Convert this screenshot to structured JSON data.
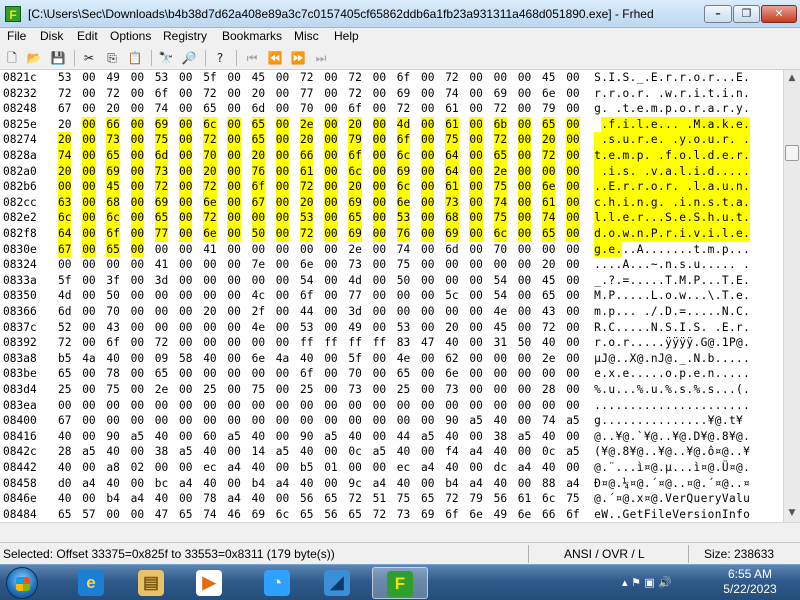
{
  "window": {
    "title": "[C:\\Users\\Sec\\Downloads\\b4b38d7d62a408e89a3c7c0157405cf65862ddb6a1fb23a931311a468d051890.exe] - Frhed",
    "app_icon_letter": "F",
    "min_glyph": "–",
    "max_glyph": "❐",
    "close_glyph": "✕"
  },
  "menu": [
    "File",
    "Disk",
    "Edit",
    "Options",
    "Registry",
    "Bookmarks",
    "Misc",
    "Help"
  ],
  "toolbar": {
    "buttons": [
      {
        "name": "new-file-icon",
        "glyph": "🗋",
        "disabled": false
      },
      {
        "name": "open-folder-icon",
        "glyph": "📂",
        "disabled": false
      },
      {
        "name": "save-icon",
        "glyph": "💾",
        "disabled": false
      },
      {
        "name": "cut-icon",
        "glyph": "✂",
        "disabled": false
      },
      {
        "name": "copy-icon",
        "glyph": "⎘",
        "disabled": false
      },
      {
        "name": "paste-icon",
        "glyph": "📋",
        "disabled": false
      },
      {
        "name": "find-icon",
        "glyph": "🔭",
        "disabled": false
      },
      {
        "name": "replace-icon",
        "glyph": "🔎",
        "disabled": false
      },
      {
        "name": "help-icon",
        "glyph": "?",
        "disabled": false
      },
      {
        "name": "bookmark-first-icon",
        "glyph": "⏮",
        "disabled": true
      },
      {
        "name": "bookmark-prev-icon",
        "glyph": "⏪",
        "disabled": true
      },
      {
        "name": "bookmark-next-icon",
        "glyph": "⏩",
        "disabled": true
      },
      {
        "name": "bookmark-last-icon",
        "glyph": "⏭",
        "disabled": true
      }
    ]
  },
  "hex": {
    "rows": [
      {
        "offset": "0821c",
        "bytes": [
          "53",
          "00",
          "49",
          "00",
          "53",
          "00",
          "5f",
          "00",
          "45",
          "00",
          "72",
          "00",
          "72",
          "00",
          "6f",
          "00",
          "72",
          "00",
          "00",
          "00",
          "45",
          "00"
        ],
        "ascii": "S.I.S._.E.r.r.o.r...E.",
        "sel": [
          0,
          0
        ]
      },
      {
        "offset": "08232",
        "bytes": [
          "72",
          "00",
          "72",
          "00",
          "6f",
          "00",
          "72",
          "00",
          "20",
          "00",
          "77",
          "00",
          "72",
          "00",
          "69",
          "00",
          "74",
          "00",
          "69",
          "00",
          "6e",
          "00"
        ],
        "ascii": "r.r.o.r. .w.r.i.t.i.n.",
        "sel": [
          0,
          0
        ]
      },
      {
        "offset": "08248",
        "bytes": [
          "67",
          "00",
          "20",
          "00",
          "74",
          "00",
          "65",
          "00",
          "6d",
          "00",
          "70",
          "00",
          "6f",
          "00",
          "72",
          "00",
          "61",
          "00",
          "72",
          "00",
          "79",
          "00"
        ],
        "ascii": "g. .t.e.m.p.o.r.a.r.y.",
        "sel": [
          0,
          0
        ]
      },
      {
        "offset": "0825e",
        "bytes": [
          "20",
          "00",
          "66",
          "00",
          "69",
          "00",
          "6c",
          "00",
          "65",
          "00",
          "2e",
          "00",
          "20",
          "00",
          "4d",
          "00",
          "61",
          "00",
          "6b",
          "00",
          "65",
          "00"
        ],
        "ascii": " .f.i.l.e... .M.a.k.e.",
        "sel": [
          1,
          22
        ]
      },
      {
        "offset": "08274",
        "bytes": [
          "20",
          "00",
          "73",
          "00",
          "75",
          "00",
          "72",
          "00",
          "65",
          "00",
          "20",
          "00",
          "79",
          "00",
          "6f",
          "00",
          "75",
          "00",
          "72",
          "00",
          "20",
          "00"
        ],
        "ascii": " .s.u.r.e. .y.o.u.r. .",
        "sel": [
          0,
          22
        ]
      },
      {
        "offset": "0828a",
        "bytes": [
          "74",
          "00",
          "65",
          "00",
          "6d",
          "00",
          "70",
          "00",
          "20",
          "00",
          "66",
          "00",
          "6f",
          "00",
          "6c",
          "00",
          "64",
          "00",
          "65",
          "00",
          "72",
          "00"
        ],
        "ascii": "t.e.m.p. .f.o.l.d.e.r.",
        "sel": [
          0,
          22
        ]
      },
      {
        "offset": "082a0",
        "bytes": [
          "20",
          "00",
          "69",
          "00",
          "73",
          "00",
          "20",
          "00",
          "76",
          "00",
          "61",
          "00",
          "6c",
          "00",
          "69",
          "00",
          "64",
          "00",
          "2e",
          "00",
          "00",
          "00"
        ],
        "ascii": " .i.s. .v.a.l.i.d.....",
        "sel": [
          0,
          22
        ]
      },
      {
        "offset": "082b6",
        "bytes": [
          "00",
          "00",
          "45",
          "00",
          "72",
          "00",
          "72",
          "00",
          "6f",
          "00",
          "72",
          "00",
          "20",
          "00",
          "6c",
          "00",
          "61",
          "00",
          "75",
          "00",
          "6e",
          "00"
        ],
        "ascii": "..E.r.r.o.r. .l.a.u.n.",
        "sel": [
          0,
          22
        ]
      },
      {
        "offset": "082cc",
        "bytes": [
          "63",
          "00",
          "68",
          "00",
          "69",
          "00",
          "6e",
          "00",
          "67",
          "00",
          "20",
          "00",
          "69",
          "00",
          "6e",
          "00",
          "73",
          "00",
          "74",
          "00",
          "61",
          "00"
        ],
        "ascii": "c.h.i.n.g. .i.n.s.t.a.",
        "sel": [
          0,
          22
        ]
      },
      {
        "offset": "082e2",
        "bytes": [
          "6c",
          "00",
          "6c",
          "00",
          "65",
          "00",
          "72",
          "00",
          "00",
          "00",
          "53",
          "00",
          "65",
          "00",
          "53",
          "00",
          "68",
          "00",
          "75",
          "00",
          "74",
          "00"
        ],
        "ascii": "l.l.e.r...S.e.S.h.u.t.",
        "sel": [
          0,
          22
        ]
      },
      {
        "offset": "082f8",
        "bytes": [
          "64",
          "00",
          "6f",
          "00",
          "77",
          "00",
          "6e",
          "00",
          "50",
          "00",
          "72",
          "00",
          "69",
          "00",
          "76",
          "00",
          "69",
          "00",
          "6c",
          "00",
          "65",
          "00"
        ],
        "ascii": "d.o.w.n.P.r.i.v.i.l.e.",
        "sel": [
          0,
          22
        ]
      },
      {
        "offset": "0830e",
        "bytes": [
          "67",
          "00",
          "65",
          "00",
          "00",
          "00",
          "41",
          "00",
          "00",
          "00",
          "00",
          "00",
          "2e",
          "00",
          "74",
          "00",
          "6d",
          "00",
          "70",
          "00",
          "00",
          "00"
        ],
        "ascii": "g.e...A.......t.m.p...",
        "sel": [
          0,
          4
        ]
      },
      {
        "offset": "08324",
        "bytes": [
          "00",
          "00",
          "00",
          "00",
          "41",
          "00",
          "00",
          "00",
          "7e",
          "00",
          "6e",
          "00",
          "73",
          "00",
          "75",
          "00",
          "00",
          "00",
          "00",
          "00",
          "20",
          "00"
        ],
        "ascii": "....A...~.n.s.u..... .",
        "sel": [
          0,
          0
        ]
      },
      {
        "offset": "0833a",
        "bytes": [
          "5f",
          "00",
          "3f",
          "00",
          "3d",
          "00",
          "00",
          "00",
          "00",
          "00",
          "54",
          "00",
          "4d",
          "00",
          "50",
          "00",
          "00",
          "00",
          "54",
          "00",
          "45",
          "00"
        ],
        "ascii": "_.?.=.....T.M.P...T.E.",
        "sel": [
          0,
          0
        ]
      },
      {
        "offset": "08350",
        "bytes": [
          "4d",
          "00",
          "50",
          "00",
          "00",
          "00",
          "00",
          "00",
          "4c",
          "00",
          "6f",
          "00",
          "77",
          "00",
          "00",
          "00",
          "5c",
          "00",
          "54",
          "00",
          "65",
          "00"
        ],
        "ascii": "M.P.....L.o.w...\\.T.e.",
        "sel": [
          0,
          0
        ]
      },
      {
        "offset": "08366",
        "bytes": [
          "6d",
          "00",
          "70",
          "00",
          "00",
          "00",
          "20",
          "00",
          "2f",
          "00",
          "44",
          "00",
          "3d",
          "00",
          "00",
          "00",
          "00",
          "00",
          "4e",
          "00",
          "43",
          "00"
        ],
        "ascii": "m.p... ./.D.=.....N.C.",
        "sel": [
          0,
          0
        ]
      },
      {
        "offset": "0837c",
        "bytes": [
          "52",
          "00",
          "43",
          "00",
          "00",
          "00",
          "00",
          "00",
          "4e",
          "00",
          "53",
          "00",
          "49",
          "00",
          "53",
          "00",
          "20",
          "00",
          "45",
          "00",
          "72",
          "00"
        ],
        "ascii": "R.C.....N.S.I.S. .E.r.",
        "sel": [
          0,
          0
        ]
      },
      {
        "offset": "08392",
        "bytes": [
          "72",
          "00",
          "6f",
          "00",
          "72",
          "00",
          "00",
          "00",
          "00",
          "00",
          "ff",
          "ff",
          "ff",
          "ff",
          "83",
          "47",
          "40",
          "00",
          "31",
          "50",
          "40",
          "00"
        ],
        "ascii": "r.o.r.....ÿÿÿÿ.G@.1P@.",
        "sel": [
          0,
          0
        ]
      },
      {
        "offset": "083a8",
        "bytes": [
          "b5",
          "4a",
          "40",
          "00",
          "09",
          "58",
          "40",
          "00",
          "6e",
          "4a",
          "40",
          "00",
          "5f",
          "00",
          "4e",
          "00",
          "62",
          "00",
          "00",
          "00",
          "2e",
          "00"
        ],
        "ascii": "µJ@..X@.nJ@._.N.b.....",
        "sel": [
          0,
          0
        ]
      },
      {
        "offset": "083be",
        "bytes": [
          "65",
          "00",
          "78",
          "00",
          "65",
          "00",
          "00",
          "00",
          "00",
          "00",
          "6f",
          "00",
          "70",
          "00",
          "65",
          "00",
          "6e",
          "00",
          "00",
          "00",
          "00",
          "00"
        ],
        "ascii": "e.x.e.....o.p.e.n.....",
        "sel": [
          0,
          0
        ]
      },
      {
        "offset": "083d4",
        "bytes": [
          "25",
          "00",
          "75",
          "00",
          "2e",
          "00",
          "25",
          "00",
          "75",
          "00",
          "25",
          "00",
          "73",
          "00",
          "25",
          "00",
          "73",
          "00",
          "00",
          "00",
          "28",
          "00"
        ],
        "ascii": "%.u...%.u.%.s.%.s...(.",
        "sel": [
          0,
          0
        ]
      },
      {
        "offset": "083ea",
        "bytes": [
          "00",
          "00",
          "00",
          "00",
          "00",
          "00",
          "00",
          "00",
          "00",
          "00",
          "00",
          "00",
          "00",
          "00",
          "00",
          "00",
          "00",
          "00",
          "00",
          "00",
          "00",
          "00"
        ],
        "ascii": "......................",
        "sel": [
          0,
          0
        ]
      },
      {
        "offset": "08400",
        "bytes": [
          "67",
          "00",
          "00",
          "00",
          "00",
          "00",
          "00",
          "00",
          "00",
          "00",
          "00",
          "00",
          "00",
          "00",
          "00",
          "00",
          "90",
          "a5",
          "40",
          "00",
          "74",
          "a5"
        ],
        "ascii": "g...............¥@.t¥",
        "sel": [
          0,
          0
        ]
      },
      {
        "offset": "08416",
        "bytes": [
          "40",
          "00",
          "90",
          "a5",
          "40",
          "00",
          "60",
          "a5",
          "40",
          "00",
          "90",
          "a5",
          "40",
          "00",
          "44",
          "a5",
          "40",
          "00",
          "38",
          "a5",
          "40",
          "00"
        ],
        "ascii": "@..¥@.`¥@..¥@.D¥@.8¥@.",
        "sel": [
          0,
          0
        ]
      },
      {
        "offset": "0842c",
        "bytes": [
          "28",
          "a5",
          "40",
          "00",
          "38",
          "a5",
          "40",
          "00",
          "14",
          "a5",
          "40",
          "00",
          "0c",
          "a5",
          "40",
          "00",
          "f4",
          "a4",
          "40",
          "00",
          "0c",
          "a5"
        ],
        "ascii": "(¥@.8¥@..¥@..¥@.ô¤@..¥",
        "sel": [
          0,
          0
        ]
      },
      {
        "offset": "08442",
        "bytes": [
          "40",
          "00",
          "a8",
          "02",
          "00",
          "00",
          "ec",
          "a4",
          "40",
          "00",
          "b5",
          "01",
          "00",
          "00",
          "ec",
          "a4",
          "40",
          "00",
          "dc",
          "a4",
          "40",
          "00"
        ],
        "ascii": "@.¨...ì¤@.µ...ì¤@.Ü¤@.",
        "sel": [
          0,
          0
        ]
      },
      {
        "offset": "08458",
        "bytes": [
          "d0",
          "a4",
          "40",
          "00",
          "bc",
          "a4",
          "40",
          "00",
          "b4",
          "a4",
          "40",
          "00",
          "9c",
          "a4",
          "40",
          "00",
          "b4",
          "a4",
          "40",
          "00",
          "88",
          "a4"
        ],
        "ascii": "Ð¤@.¼¤@.´¤@..¤@.´¤@..¤",
        "sel": [
          0,
          0
        ]
      },
      {
        "offset": "0846e",
        "bytes": [
          "40",
          "00",
          "b4",
          "a4",
          "40",
          "00",
          "78",
          "a4",
          "40",
          "00",
          "56",
          "65",
          "72",
          "51",
          "75",
          "65",
          "72",
          "79",
          "56",
          "61",
          "6c",
          "75"
        ],
        "ascii": "@.´¤@.x¤@.VerQueryValu",
        "sel": [
          0,
          0
        ]
      },
      {
        "offset": "08484",
        "bytes": [
          "65",
          "57",
          "00",
          "00",
          "47",
          "65",
          "74",
          "46",
          "69",
          "6c",
          "65",
          "56",
          "65",
          "72",
          "73",
          "69",
          "6f",
          "6e",
          "49",
          "6e",
          "66",
          "6f"
        ],
        "ascii": "eW..GetFileVersionInfo",
        "sel": [
          0,
          0
        ]
      },
      {
        "offset": "0849a",
        "bytes": [
          "57",
          "00",
          "47",
          "65",
          "74",
          "46",
          "69",
          "6c",
          "65",
          "56",
          "65",
          "72",
          "73",
          "69",
          "6f",
          "6e",
          "49",
          "6e",
          "66",
          "6f",
          "53",
          "69"
        ],
        "ascii": "W.GetFileVersionInfoSi",
        "sel": [
          0,
          0
        ]
      }
    ]
  },
  "scrollbar": {
    "up_glyph": "▲",
    "down_glyph": "▼"
  },
  "status": {
    "selection": "Selected: Offset 33375=0x825f to 33553=0x8311 (179 byte(s))",
    "mode": "ANSI / OVR / L",
    "size": "Size: 238633"
  },
  "taskbar": {
    "apps": [
      {
        "name": "internet-explorer-icon",
        "glyph": "e",
        "bg": "#1b7fd6",
        "fg": "#ffd23f",
        "active": false
      },
      {
        "name": "file-explorer-icon",
        "glyph": "▤",
        "bg": "#e8c266",
        "fg": "#7a5a12",
        "active": false
      },
      {
        "name": "media-player-icon",
        "glyph": "▶",
        "bg": "#ffffff",
        "fg": "#e06b12",
        "active": false
      },
      {
        "name": "browser-icon",
        "glyph": "◔",
        "bg": "#2ea0ff",
        "fg": "#ffffff",
        "active": false
      },
      {
        "name": "wireshark-icon",
        "glyph": "◢",
        "bg": "#3a8fd6",
        "fg": "#0c3b6a",
        "active": false
      },
      {
        "name": "frhed-taskbar-icon",
        "glyph": "F",
        "bg": "#2f9e2f",
        "fg": "#f5e400",
        "active": true
      }
    ],
    "tray": "▴  ⚑  ▣  🔊",
    "time": "6:55 AM",
    "date": "5/22/2023"
  }
}
